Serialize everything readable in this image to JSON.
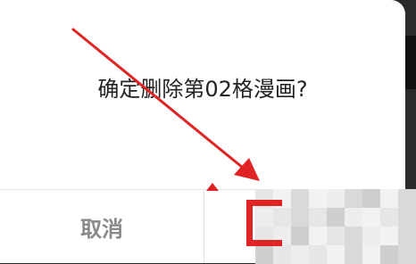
{
  "dialog": {
    "message": "确定删除第02格漫画?",
    "cancel_label": "取消"
  },
  "annotation": {
    "arrow_color": "#e02424",
    "highlight_color": "#e02424"
  },
  "colors": {
    "dialog_background": "#ffffff",
    "message_text": "#222222",
    "cancel_text": "#8a8a8a",
    "divider": "#e3e3e3"
  }
}
